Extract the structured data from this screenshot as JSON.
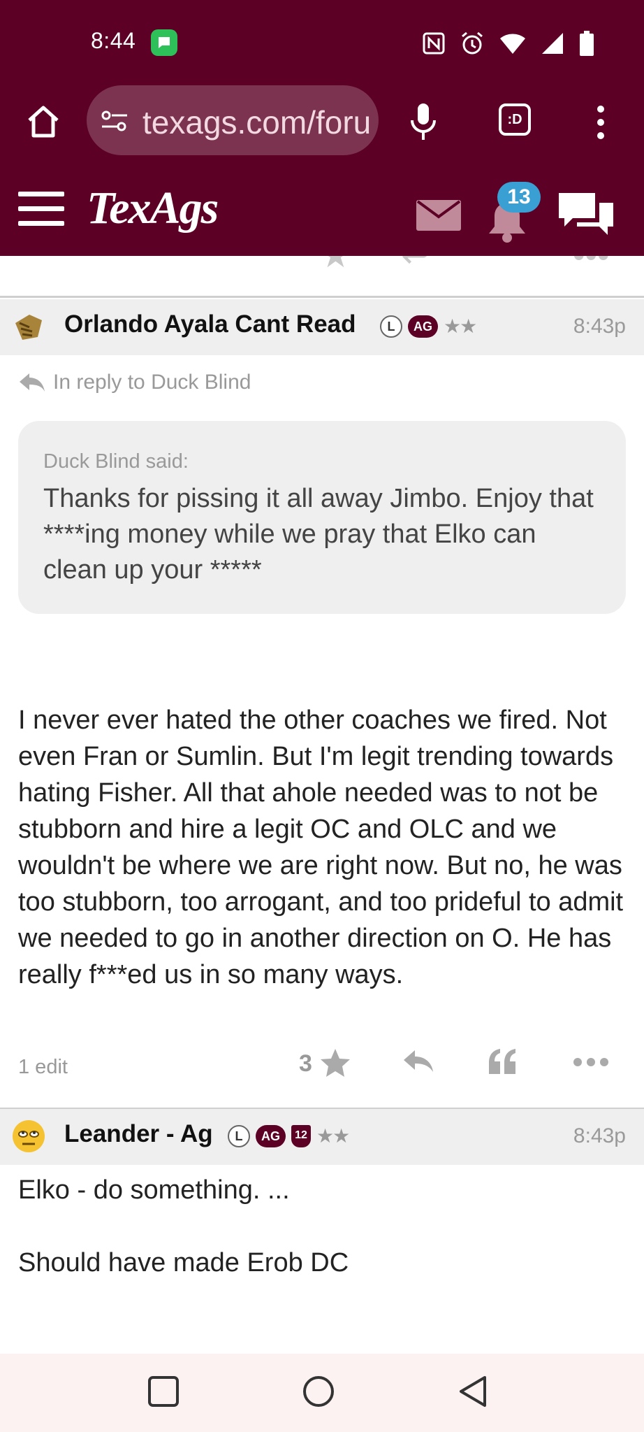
{
  "status_bar": {
    "time": "8:44"
  },
  "browser": {
    "url": "texags.com/forums",
    "tabs_label": ":D"
  },
  "site": {
    "logo": "TexAgs",
    "notification_count": "13"
  },
  "posts": [
    {
      "author": "Orlando Ayala Cant Read",
      "badge_l": "L",
      "badge_ag": "AG",
      "stars": "★★",
      "time": "8:43p",
      "reply_to": "In reply to Duck Blind",
      "quote_author": "Duck Blind said:",
      "quote_text": "Thanks for pissing it all away Jimbo. Enjoy that ****ing money while we pray that Elko can clean up your *****",
      "body": "I never ever hated the other coaches we fired. Not even Fran or Sumlin. But I'm legit trending towards hating Fisher. All that ahole needed was to not be stubborn and hire a legit OC and OLC and we wouldn't be where we are right now. But no, he was too stubborn, too arrogant, and too prideful to admit we needed to go in another direction on O. He has really f***ed us in so many ways.",
      "edit_count": "1 edit",
      "votes": "3"
    },
    {
      "author": "Leander - Ag",
      "badge_l": "L",
      "badge_ag": "AG",
      "badge_12": "12",
      "stars": "★★",
      "time": "8:43p",
      "body_line1": "Elko - do something. ...",
      "body_line2": "Should have made Erob DC"
    }
  ],
  "colors": {
    "maroon": "#5c0025",
    "badge_blue": "#3aa0d4",
    "header_gray": "#efefef"
  }
}
